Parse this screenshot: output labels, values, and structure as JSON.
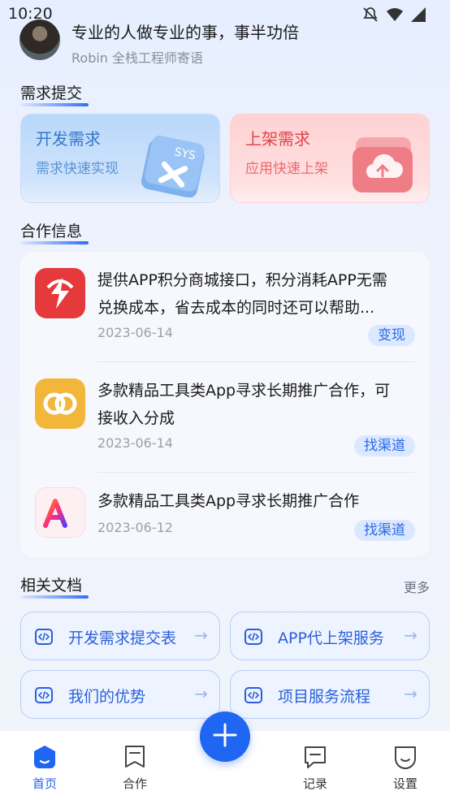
{
  "status_bar": {
    "time": "10:20"
  },
  "header": {
    "slogan": "专业的人做专业的事，事半功倍",
    "author": "Robin  全栈工程师寄语"
  },
  "sections": {
    "demand": "需求提交",
    "coop": "合作信息",
    "docs": "相关文档",
    "more": "更多"
  },
  "demand_cards": [
    {
      "title": "开发需求",
      "subtitle": "需求快速实现",
      "badge": "SYS"
    },
    {
      "title": "上架需求",
      "subtitle": "应用快速上架"
    }
  ],
  "coop_items": [
    {
      "text_line1": "提供APP积分商城接口，积分消耗APP无需",
      "text_line2": "兑换成本，省去成本的同时还可以帮助...",
      "date": "2023-06-14",
      "tag": "变现",
      "logo": "red-s-logo"
    },
    {
      "text_line1": "多款精品工具类App寻求长期推广合作，可",
      "text_line2": "接收入分成",
      "date": "2023-06-14",
      "tag": "找渠道",
      "logo": "orange-link-logo"
    },
    {
      "text_line1": "多款精品工具类App寻求长期推广合作",
      "date": "2023-06-12",
      "tag": "找渠道",
      "logo": "ai-logo"
    }
  ],
  "docs": [
    {
      "label": "开发需求提交表"
    },
    {
      "label": "APP代上架服务"
    },
    {
      "label": "我们的优势"
    },
    {
      "label": "项目服务流程"
    }
  ],
  "tabs": [
    {
      "label": "首页"
    },
    {
      "label": "合作"
    },
    {
      "label": "记录"
    },
    {
      "label": "设置"
    }
  ],
  "colors": {
    "accent": "#1f66f2",
    "tag_bg": "#dbe8ff",
    "tag_text": "#2a6be8"
  }
}
